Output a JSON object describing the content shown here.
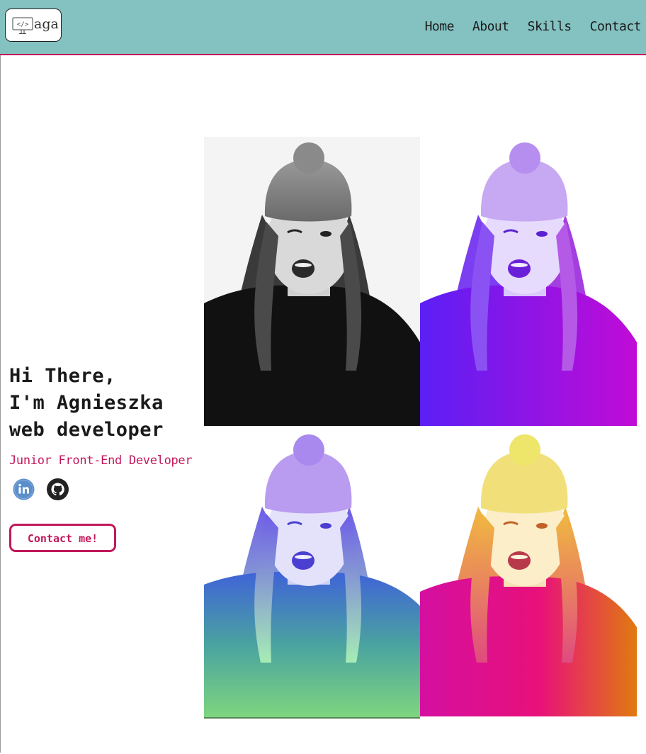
{
  "header": {
    "logo_text": "aga",
    "logo_icon": "code-monitor-icon",
    "nav": [
      "Home",
      "About",
      "Skills",
      "Contact"
    ]
  },
  "hero": {
    "lines": [
      "Hi There,",
      "I'm Agnieszka",
      "web developer"
    ],
    "subtitle": "Junior Front-End Developer",
    "cta_label": "Contact me!"
  },
  "socials": [
    {
      "icon": "linkedin-icon",
      "color": "#5b8fcc"
    },
    {
      "icon": "github-icon",
      "color": "#222222"
    }
  ],
  "photos": [
    {
      "variant": "grayscale"
    },
    {
      "variant": "purple-tint"
    },
    {
      "variant": "purple-green-gradient"
    },
    {
      "variant": "pink-yellow-gradient"
    }
  ],
  "colors": {
    "header_bg": "#84c1c1",
    "accent": "#c2185b",
    "text": "#1a1a1a"
  }
}
